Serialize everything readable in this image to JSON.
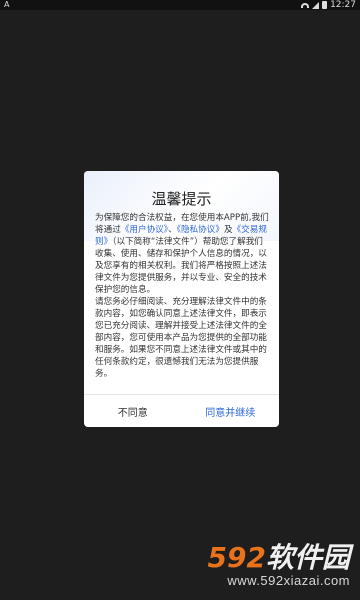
{
  "statusbar": {
    "left_icon": "A",
    "time": "12:27"
  },
  "dialog": {
    "title": "温馨提示",
    "body": [
      {
        "text": "为保障您的合法权益，在您使用本APP前,我们将通过"
      },
      {
        "text": "《用户协议》",
        "link": true
      },
      {
        "text": "、"
      },
      {
        "text": "《隐私协议》",
        "link": true
      },
      {
        "text": "及"
      },
      {
        "text": "《交易规则》",
        "link": true
      },
      {
        "text": "（以下简称“法律文件”）帮助您了解我们收集、使用、储存和保护个人信息的情况，以及您享有的相关权利。我们将严格按照上述法律文件为您提供服务，并以专业、安全的技术保护您的信息。"
      },
      {
        "text": "\n请您务必仔细阅读、充分理解法律文件中的条款内容，如您确认同意上述法律文件，即表示您已充分阅读、理解并接受上述法律文件的全部内容，您可使用本产品为您提供的全部功能和服务。如果您不同意上述法律文件或其中的任何条款约定，很遗憾我们无法为您提供服务。"
      }
    ],
    "decline_label": "不同意",
    "accept_label": "同意并继续"
  },
  "watermark": {
    "logo_number": "592",
    "logo_text": "软件园",
    "url": "www.592xiazai.com"
  },
  "colors": {
    "link": "#2e67d6",
    "accent_orange": "#e8731c"
  }
}
